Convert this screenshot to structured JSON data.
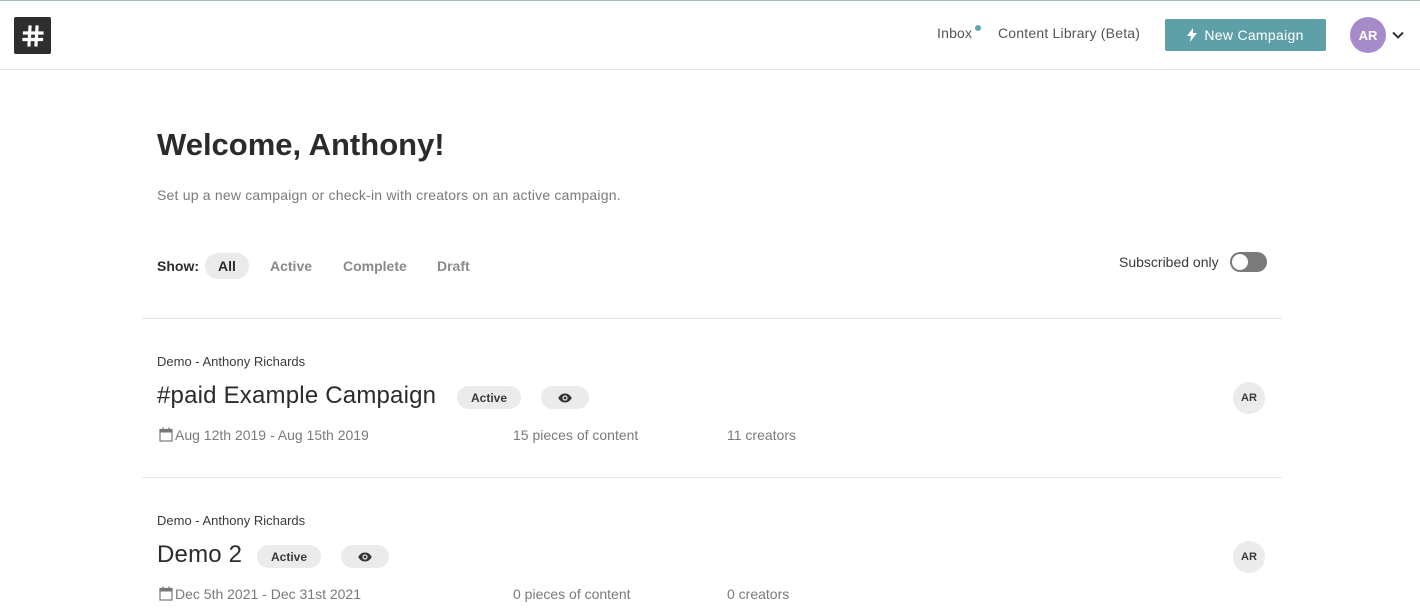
{
  "header": {
    "logo_icon": "hashtag-logo-icon",
    "nav": {
      "inbox": "Inbox",
      "content_library": "Content Library (Beta)"
    },
    "new_campaign_label": "New Campaign",
    "new_campaign_icon": "lightning-bolt-icon",
    "user_initials": "AR",
    "colors": {
      "accent": "#5f9fa8",
      "avatar": "#a58bc9",
      "inbox_dot": "#5ea7ad"
    }
  },
  "main": {
    "welcome": "Welcome, Anthony!",
    "subtitle": "Set up a new campaign or check-in with creators on an active campaign.",
    "filter": {
      "label": "Show:",
      "options": [
        "All",
        "Active",
        "Complete",
        "Draft"
      ],
      "selected": "All"
    },
    "subscribed": {
      "label": "Subscribed only",
      "on": false
    }
  },
  "campaigns": [
    {
      "org": "Demo - Anthony Richards",
      "title": "#paid Example Campaign",
      "status": "Active",
      "dates": "Aug 12th 2019 - Aug 15th 2019",
      "pieces": "15 pieces of content",
      "creators": "11 creators",
      "owner_initials": "AR"
    },
    {
      "org": "Demo - Anthony Richards",
      "title": "Demo 2",
      "status": "Active",
      "dates": "Dec 5th 2021 - Dec 31st 2021",
      "pieces": "0 pieces of content",
      "creators": "0 creators",
      "owner_initials": "AR"
    }
  ]
}
